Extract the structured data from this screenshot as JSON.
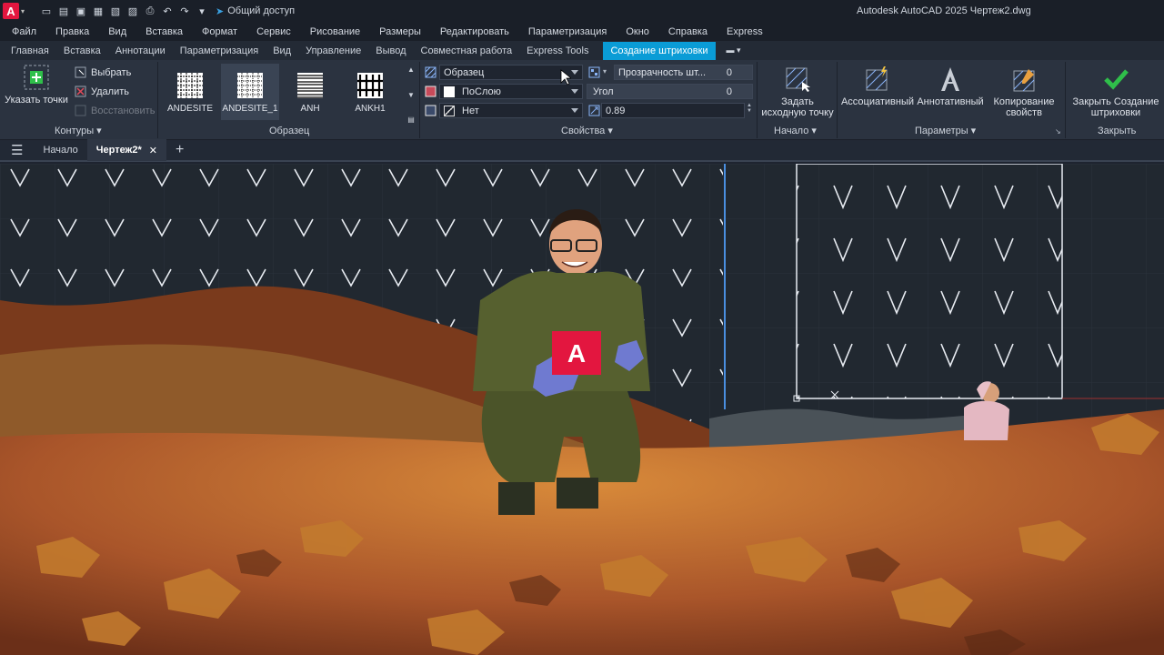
{
  "titlebar": {
    "app_icon": "autocad-logo-icon",
    "share_label": "Общий доступ",
    "window_title": "Autodesk AutoCAD 2025    Чертеж2.dwg"
  },
  "menubar": {
    "items": [
      "Файл",
      "Правка",
      "Вид",
      "Вставка",
      "Формат",
      "Сервис",
      "Рисование",
      "Размеры",
      "Редактировать",
      "Параметризация",
      "Окно",
      "Справка",
      "Express"
    ]
  },
  "ribbon_tabs": {
    "items": [
      "Главная",
      "Вставка",
      "Аннотации",
      "Параметризация",
      "Вид",
      "Управление",
      "Вывод",
      "Совместная работа",
      "Express Tools"
    ],
    "active": "Создание штриховки"
  },
  "ribbon": {
    "contours": {
      "pick_points": "Указать точки",
      "select": "Выбрать",
      "remove": "Удалить",
      "recreate": "Восстановить",
      "panel": "Контуры"
    },
    "pattern": {
      "items": [
        "ANDESITE",
        "ANDESITE_1",
        "ANH",
        "ANKH1"
      ],
      "selected": "ANDESITE_1",
      "panel": "Образец"
    },
    "properties": {
      "type_value": "Образец",
      "color_value": "ПоСлою",
      "background_value": "Нет",
      "transparency_label": "Прозрачность шт...",
      "transparency_value": "0",
      "angle_label": "Угол",
      "angle_value": "0",
      "scale_value": "0.89",
      "panel": "Свойства"
    },
    "origin": {
      "set_origin": "Задать исходную точку",
      "panel": "Начало"
    },
    "options": {
      "associative": "Ассоциативный",
      "annotative": "Аннотативный",
      "match_props": "Копирование свойств",
      "panel": "Параметры"
    },
    "close": {
      "close_label": "Закрыть Создание штриховки",
      "panel": "Закрыть"
    }
  },
  "doc_tabs": {
    "start": "Начало",
    "current": "Чертеж2*"
  },
  "overlay": {
    "badge_letter": "A"
  },
  "colors": {
    "accent": "#0a9cd6",
    "brand": "#e3163f",
    "canvas": "#212830",
    "close_check": "#2fbf4a"
  }
}
